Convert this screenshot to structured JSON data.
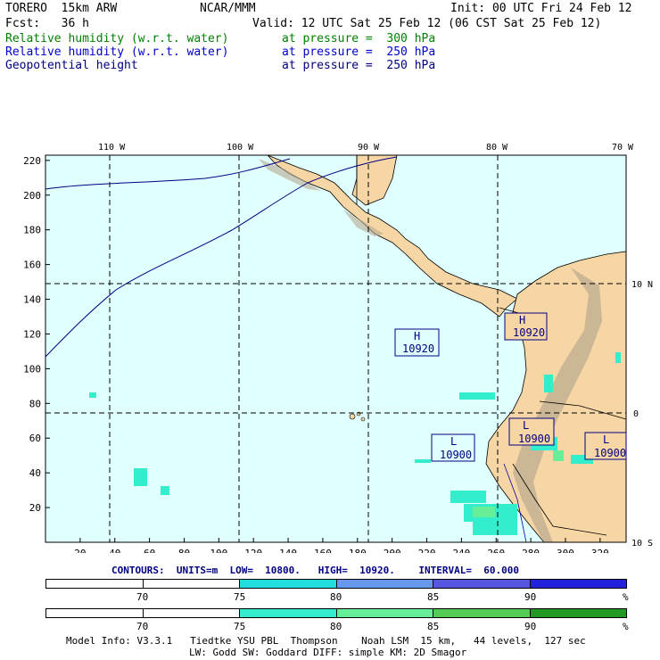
{
  "header": {
    "model": "TORERO  15km ARW",
    "org": "NCAR/MMM",
    "init": "Init: 00 UTC Fri 24 Feb 12",
    "fcst": "Fcst:   36 h",
    "valid": "Valid: 12 UTC Sat 25 Feb 12 (06 CST Sat 25 Feb 12)"
  },
  "fields": [
    {
      "label": "Relative humidity (w.r.t. water)",
      "level": "at pressure =  300 hPa",
      "color": "#008000"
    },
    {
      "label": "Relative humidity (w.r.t. water)",
      "level": "at pressure =  250 hPa",
      "color": "#0000cc"
    },
    {
      "label": "Geopotential height",
      "level": "at pressure =  250 hPa",
      "color": "#000080"
    }
  ],
  "map": {
    "top_lon_labels": [
      "110 W",
      "100 W",
      "90 W",
      "80 W",
      "70 W"
    ],
    "right_lat_labels": [
      "10 N",
      "0",
      "10 S"
    ],
    "x_ticks": [
      "20",
      "40",
      "60",
      "80",
      "100",
      "120",
      "140",
      "160",
      "180",
      "200",
      "220",
      "240",
      "260",
      "280",
      "300",
      "320"
    ],
    "y_ticks": [
      "220",
      "200",
      "180",
      "160",
      "140",
      "120",
      "100",
      "80",
      "60",
      "40",
      "20"
    ],
    "ocean_color": "#e0ffff",
    "land_color": "#f7d6a6",
    "labels": [
      {
        "type": "H",
        "value": "10920"
      },
      {
        "type": "H",
        "value": "10920"
      },
      {
        "type": "L",
        "value": "10900"
      },
      {
        "type": "L",
        "value": "10900"
      },
      {
        "type": "L",
        "value": "10900"
      }
    ]
  },
  "contours_line": "CONTOURS:  UNITS=m  LOW=  10800.   HIGH=  10920.    INTERVAL=  60.000",
  "colorbar1": {
    "labels": [
      "70",
      "75",
      "80",
      "85",
      "90"
    ],
    "unit": "%",
    "colors": [
      "#ffffff",
      "#ffffff",
      "#22dddd",
      "#6699ee",
      "#5555dd",
      "#2222dd"
    ]
  },
  "colorbar2": {
    "labels": [
      "70",
      "75",
      "80",
      "85",
      "90"
    ],
    "unit": "%",
    "colors": [
      "#ffffff",
      "#ffffff",
      "#33eecc",
      "#66ee99",
      "#55cc55",
      "#229922"
    ]
  },
  "footer": {
    "line1": "Model Info: V3.3.1   Tiedtke YSU PBL  Thompson    Noah LSM  15 km,   44 levels,  127 sec",
    "line2": "LW: Godd SW: Goddard DIFF: simple KM: 2D Smagor"
  }
}
